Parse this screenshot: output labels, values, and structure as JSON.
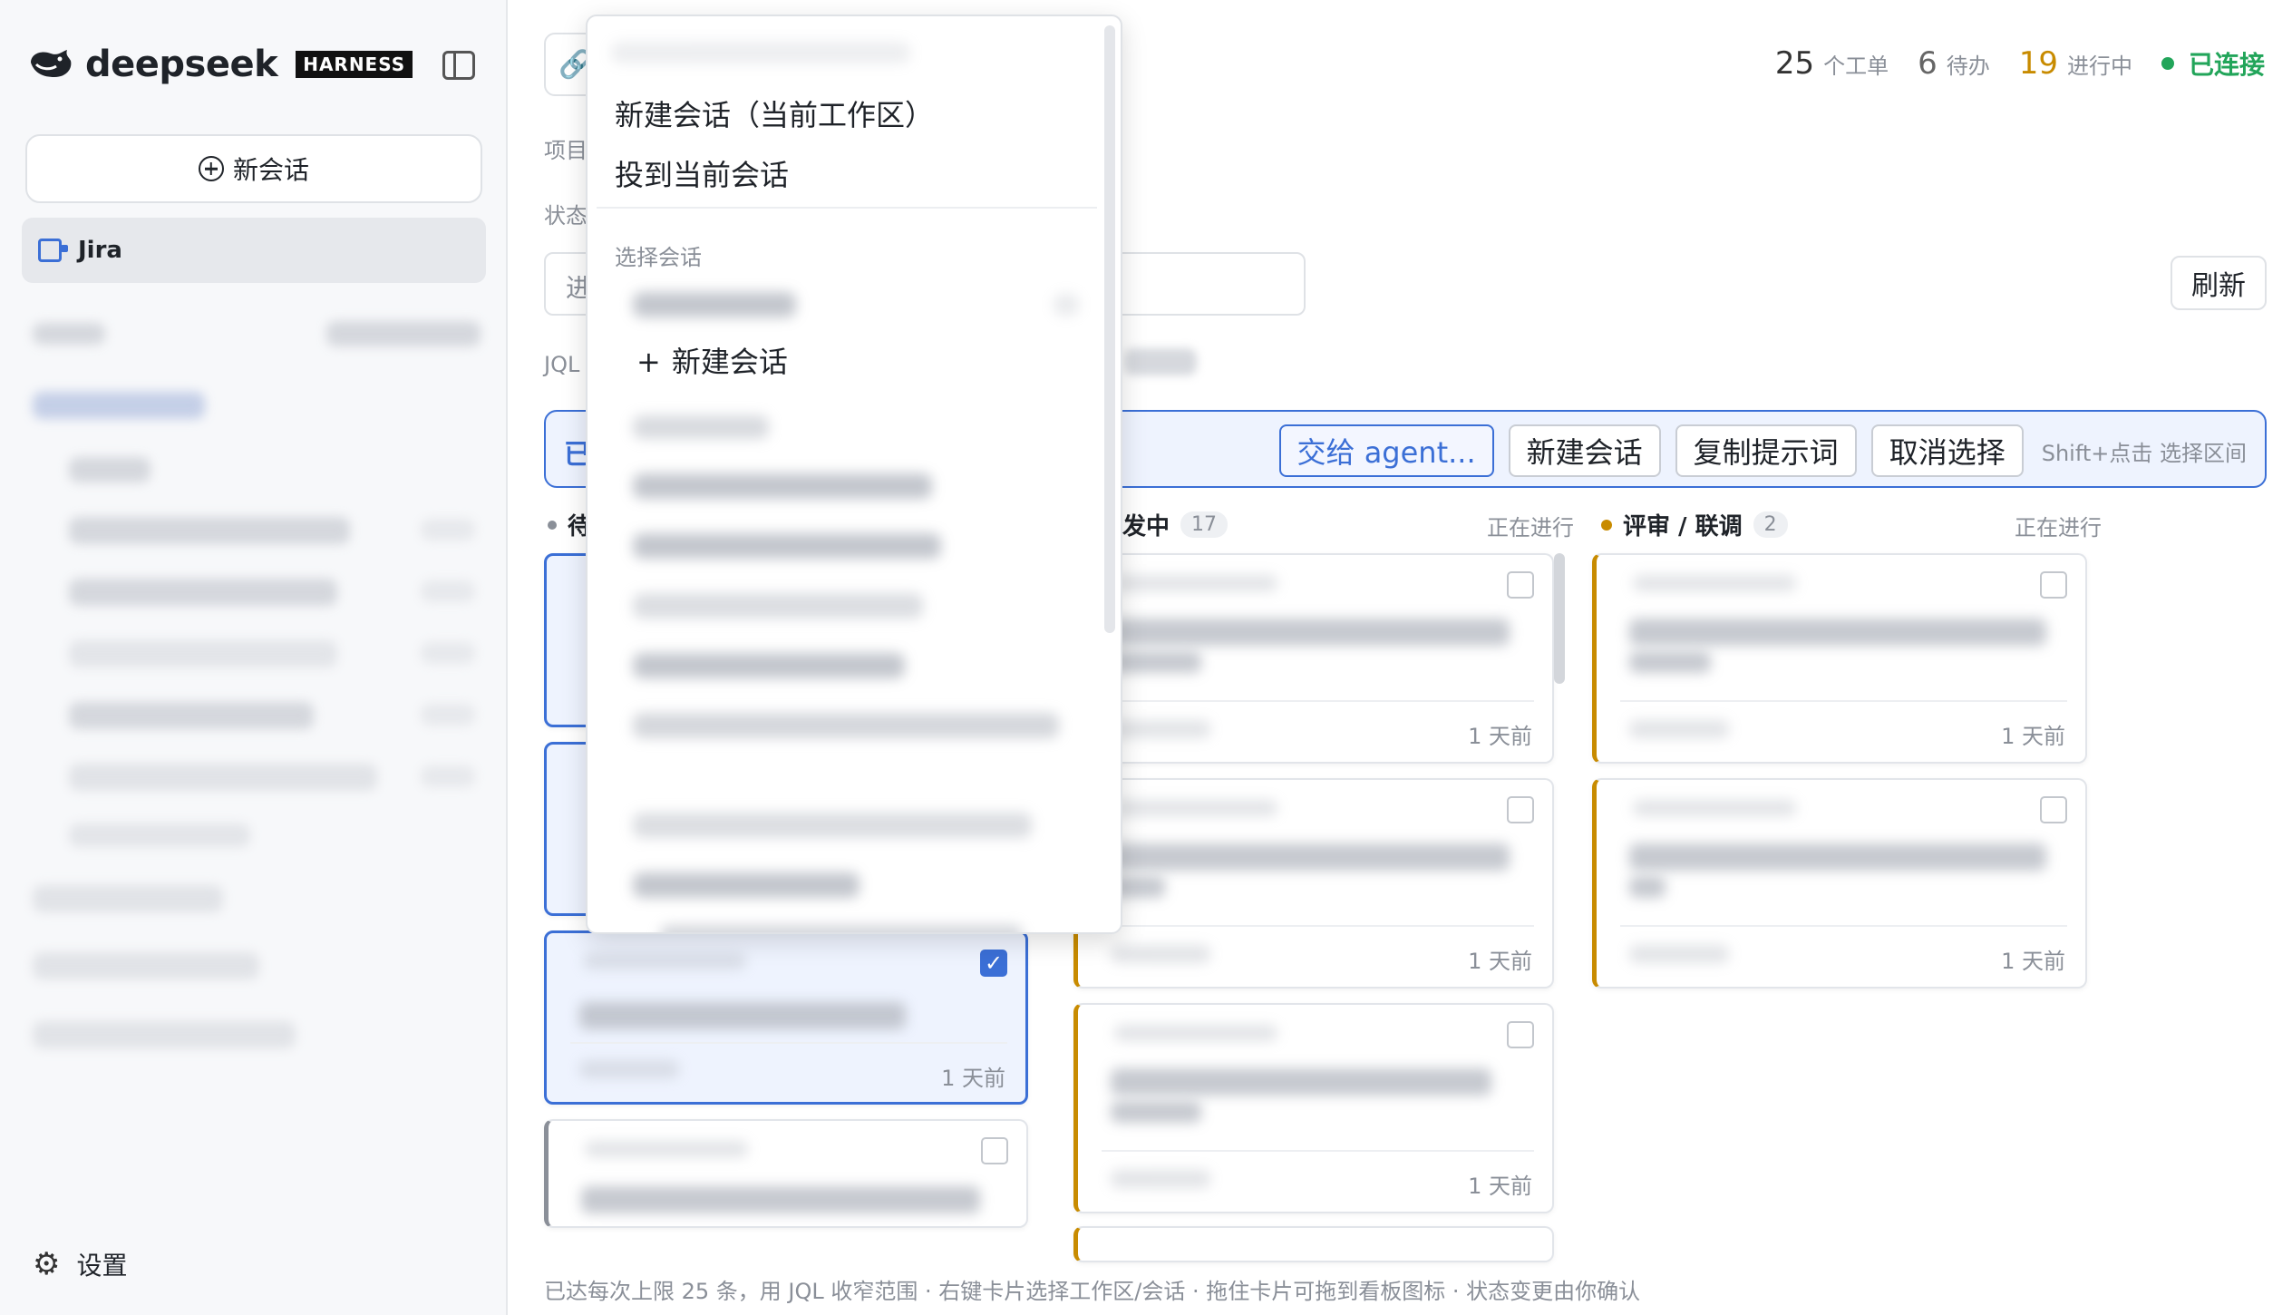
{
  "sidebar": {
    "logo_text": "deepseek",
    "logo_badge": "HARNESS",
    "new_chat_label": "新会话",
    "nav_item": "Jira",
    "settings_label": "设置"
  },
  "header": {
    "total_count": "25",
    "total_unit": "个工单",
    "todo_count": "6",
    "todo_unit": "待办",
    "progress_count": "19",
    "progress_unit": "进行中",
    "status": "已连接"
  },
  "filters": {
    "project_label": "项目",
    "status_label": "状态",
    "search_placeholder": "进",
    "jql_label": "JQL",
    "refresh_label": "刷新"
  },
  "selection_bar": {
    "text": "已",
    "hand_to_agent": "交给 agent...",
    "new_chat": "新建会话",
    "copy_prompt": "复制提示词",
    "cancel": "取消选择",
    "hint": "Shift+点击 选择区间"
  },
  "columns": [
    {
      "title": "待",
      "count": "",
      "status": ""
    },
    {
      "title": "发中",
      "count": "17",
      "status": "正在进行"
    },
    {
      "title": "评审 / 联调",
      "count": "2",
      "status": "正在进行"
    }
  ],
  "cards": {
    "time": "1 天前",
    "checkmark": "✓"
  },
  "context_menu": {
    "item_new_chat_workspace": "新建会话（当前工作区）",
    "item_send_current": "投到当前会话",
    "section_label": "选择会话",
    "item_new_chat": "新建会话",
    "plus": "+"
  },
  "footer_note": "已达每次上限 25 条，用 JQL 收窄范围 · 右键卡片选择工作区/会话 · 拖住卡片可拖到看板图标 · 状态变更由你确认",
  "colors": {
    "accent_blue": "#3b6fd6",
    "in_progress_orange": "#c88b00",
    "connected_green": "#22a55a"
  }
}
